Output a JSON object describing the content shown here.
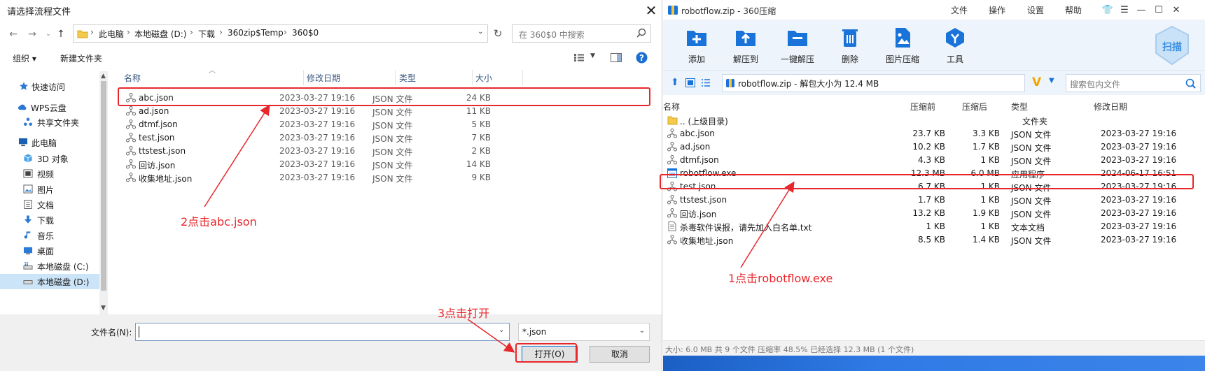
{
  "dialog": {
    "title": "请选择流程文件",
    "breadcrumb": [
      "此电脑",
      "本地磁盘 (D:)",
      "下载",
      "360zip$Temp",
      "360$0"
    ],
    "search_placeholder": "在 360$0 中搜索",
    "toolbar": {
      "organize": "组织 ▾",
      "new_folder": "新建文件夹"
    },
    "nav": [
      {
        "label": "快速访问",
        "icon": "star-icon"
      },
      {
        "label": "WPS云盘",
        "icon": "cloud-icon"
      },
      {
        "label": "共享文件夹",
        "icon": "share-icon"
      },
      {
        "label": "此电脑",
        "icon": "computer-icon"
      },
      {
        "label": "3D 对象",
        "icon": "cube-icon"
      },
      {
        "label": "视频",
        "icon": "video-icon"
      },
      {
        "label": "图片",
        "icon": "picture-icon"
      },
      {
        "label": "文档",
        "icon": "document-icon"
      },
      {
        "label": "下载",
        "icon": "download-icon"
      },
      {
        "label": "音乐",
        "icon": "music-icon"
      },
      {
        "label": "桌面",
        "icon": "desktop-icon"
      },
      {
        "label": "本地磁盘 (C:)",
        "icon": "drive-icon"
      },
      {
        "label": "本地磁盘 (D:)",
        "icon": "drive-icon"
      }
    ],
    "columns": [
      "名称",
      "修改日期",
      "类型",
      "大小"
    ],
    "files": [
      {
        "name": "abc.json",
        "date": "2023-03-27 19:16",
        "type": "JSON 文件",
        "size": "24 KB"
      },
      {
        "name": "ad.json",
        "date": "2023-03-27 19:16",
        "type": "JSON 文件",
        "size": "11 KB"
      },
      {
        "name": "dtmf.json",
        "date": "2023-03-27 19:16",
        "type": "JSON 文件",
        "size": "5 KB"
      },
      {
        "name": "test.json",
        "date": "2023-03-27 19:16",
        "type": "JSON 文件",
        "size": "7 KB"
      },
      {
        "name": "ttstest.json",
        "date": "2023-03-27 19:16",
        "type": "JSON 文件",
        "size": "2 KB"
      },
      {
        "name": "回访.json",
        "date": "2023-03-27 19:16",
        "type": "JSON 文件",
        "size": "14 KB"
      },
      {
        "name": "收集地址.json",
        "date": "2023-03-27 19:16",
        "type": "JSON 文件",
        "size": "9 KB"
      }
    ],
    "filename_label": "文件名(N):",
    "filename_value": "",
    "filetype": "*.json",
    "open_button": "打开(O)",
    "cancel_button": "取消"
  },
  "archive": {
    "title": "robotflow.zip - 360压缩",
    "menu": [
      "文件",
      "操作",
      "设置",
      "帮助"
    ],
    "tools": [
      {
        "label": "添加",
        "icon": "add-icon"
      },
      {
        "label": "解压到",
        "icon": "extract-to-icon"
      },
      {
        "label": "一键解压",
        "icon": "one-click-extract-icon"
      },
      {
        "label": "删除",
        "icon": "delete-icon"
      },
      {
        "label": "图片压缩",
        "icon": "image-compress-icon"
      },
      {
        "label": "工具",
        "icon": "tools-icon"
      }
    ],
    "scan_label": "扫描",
    "path": "robotflow.zip - 解包大小为 12.4 MB",
    "search_placeholder": "搜索包内文件",
    "columns": [
      "名称",
      "压缩前",
      "压缩后",
      "类型",
      "修改日期"
    ],
    "files": [
      {
        "name": ".. (上级目录)",
        "before": "",
        "after": "",
        "type": "文件夹",
        "date": "",
        "icon": "folder-icon"
      },
      {
        "name": "abc.json",
        "before": "23.7 KB",
        "after": "3.3 KB",
        "type": "JSON 文件",
        "date": "2023-03-27 19:16",
        "icon": "json-icon"
      },
      {
        "name": "ad.json",
        "before": "10.2 KB",
        "after": "1.7 KB",
        "type": "JSON 文件",
        "date": "2023-03-27 19:16",
        "icon": "json-icon"
      },
      {
        "name": "dtmf.json",
        "before": "4.3 KB",
        "after": "1 KB",
        "type": "JSON 文件",
        "date": "2023-03-27 19:16",
        "icon": "json-icon"
      },
      {
        "name": "robotflow.exe",
        "before": "12.3 MB",
        "after": "6.0 MB",
        "type": "应用程序",
        "date": "2024-06-17 16:51",
        "icon": "exe-icon"
      },
      {
        "name": "test.json",
        "before": "6.7 KB",
        "after": "1 KB",
        "type": "JSON 文件",
        "date": "2023-03-27 19:16",
        "icon": "json-icon"
      },
      {
        "name": "ttstest.json",
        "before": "1.7 KB",
        "after": "1 KB",
        "type": "JSON 文件",
        "date": "2023-03-27 19:16",
        "icon": "json-icon"
      },
      {
        "name": "回访.json",
        "before": "13.2 KB",
        "after": "1.9 KB",
        "type": "JSON 文件",
        "date": "2023-03-27 19:16",
        "icon": "json-icon"
      },
      {
        "name": "杀毒软件误报，请先加入白名单.txt",
        "before": "1 KB",
        "after": "1 KB",
        "type": "文本文档",
        "date": "2023-03-27 19:16",
        "icon": "text-icon"
      },
      {
        "name": "收集地址.json",
        "before": "8.5 KB",
        "after": "1.4 KB",
        "type": "JSON 文件",
        "date": "2023-03-27 19:16",
        "icon": "json-icon"
      }
    ],
    "status": "大小: 6.0 MB 共 9 个文件 压缩率 48.5% 已经选择 12.3 MB (1 个文件)"
  },
  "annotations": {
    "step1": "1点击robotflow.exe",
    "step2": "2点击abc.json",
    "step3": "3点击打开"
  },
  "colors": {
    "highlight": "#e8272c",
    "accent": "#1a73d9"
  }
}
